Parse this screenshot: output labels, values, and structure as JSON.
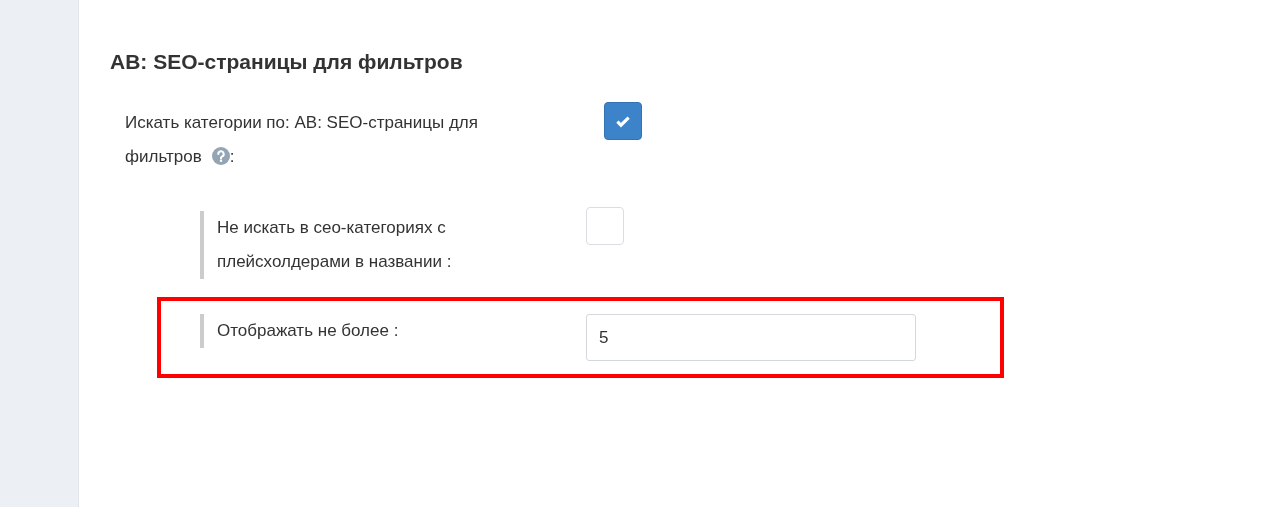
{
  "section": {
    "title": "АВ: SEO-страницы для фильтров"
  },
  "settings": [
    {
      "kind": "checkbox",
      "label_lines": [
        "Искать категории по: АВ: SEO-страницы для",
        "фильтров"
      ],
      "help": true,
      "label_end": ":",
      "checked": true,
      "children": [
        {
          "kind": "checkbox",
          "label": "Не искать в сео-категориях с плейсхолдерами в названии :",
          "checked": false,
          "highlighted": false
        },
        {
          "kind": "number",
          "label": "Отображать не более :",
          "value": "5",
          "highlighted": true
        }
      ]
    }
  ]
}
